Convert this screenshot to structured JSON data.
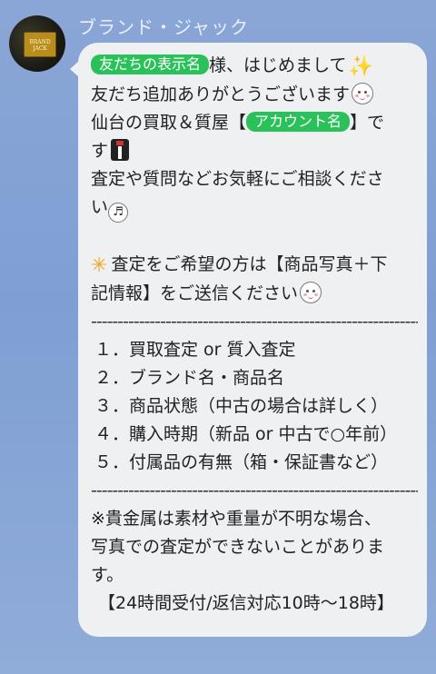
{
  "chat": {
    "sender_name": "ブランド・ジャック",
    "avatar_sign_text": "BRAND JACK"
  },
  "message": {
    "tag_friend_name": "友だちの表示名",
    "greeting_after_tag": "様、はじめまして",
    "line2": "友だち追加ありがとうございます",
    "line3_before_tag": "仙台の買取＆質屋【",
    "tag_account_name": "アカウント名",
    "line3_after_tag": "】で",
    "line4": "す",
    "line5": "査定や質問などお気軽にご相談くださ",
    "line6": "い",
    "line8": "査定をご希望の方は【商品写真＋下",
    "line9": "記情報】をご送信ください",
    "divider": "----------------------------------------------------------------",
    "items": [
      "１．買取査定 or 質入査定",
      "２．ブランド名・商品名",
      "３．商品状態（中古の場合は詳しく）",
      "４．購入時期（新品 or 中古で○年前）",
      "５．付属品の有無（箱・保証書など）"
    ],
    "note_line1": "※貴金属は素材や重量が不明な場合、",
    "note_line2": "写真での査定ができないことがありま",
    "note_line3": "す。",
    "hours": "【24時間受付/返信対応10時～18時】"
  },
  "icons": {
    "sparkle": "sparkle-icon",
    "smile": "smile-emoji-icon",
    "tuxedo": "tuxedo-icon",
    "note": "music-note-icon",
    "star": "star-icon",
    "grin": "grin-emoji-icon"
  },
  "colors": {
    "background": "#8aa6d6",
    "bubble": "#eef0f2",
    "tag": "#2bc15a"
  }
}
